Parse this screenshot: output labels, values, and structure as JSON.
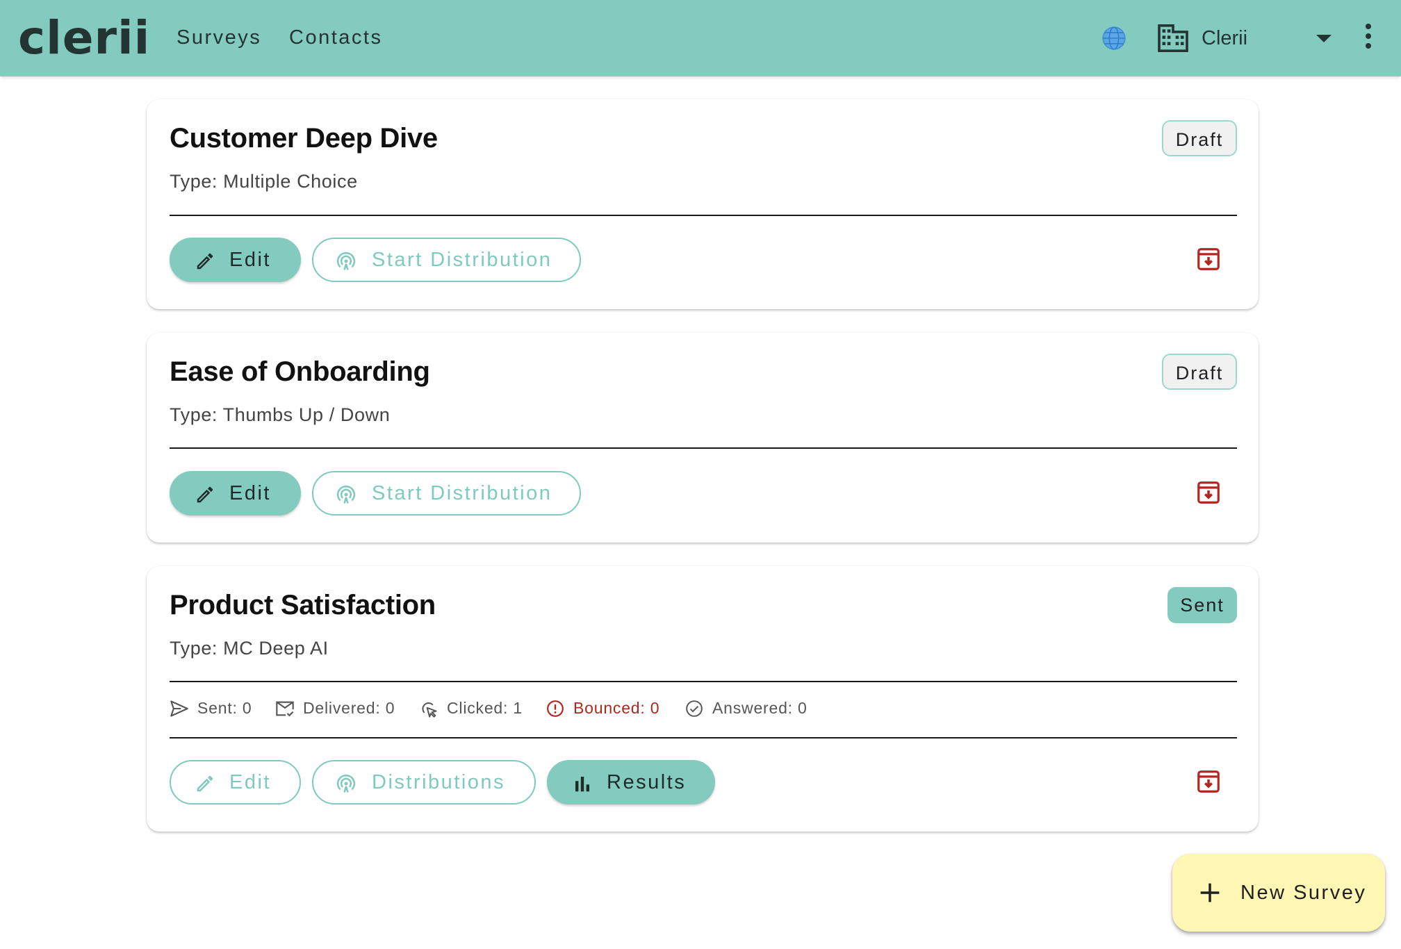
{
  "header": {
    "logo": "clerii",
    "nav": [
      {
        "label": "Surveys"
      },
      {
        "label": "Contacts"
      }
    ],
    "organization": "Clerii",
    "icons": [
      "globe-icon",
      "building-icon",
      "chevron-down-icon",
      "more-vert-icon"
    ]
  },
  "colors": {
    "primary": "#82cbbe",
    "danger": "#b3261e",
    "fab": "#fff7b3"
  },
  "surveys": [
    {
      "title": "Customer Deep Dive",
      "type": "Type: Multiple Choice",
      "status": "Draft",
      "actions": {
        "edit": "Edit",
        "distribute": "Start Distribution"
      }
    },
    {
      "title": "Ease of Onboarding",
      "type": "Type: Thumbs Up / Down",
      "status": "Draft",
      "actions": {
        "edit": "Edit",
        "distribute": "Start Distribution"
      }
    },
    {
      "title": "Product Satisfaction",
      "type": "Type: MC Deep AI",
      "status": "Sent",
      "stats": {
        "sent": "Sent: 0",
        "delivered": "Delivered: 0",
        "clicked": "Clicked: 1",
        "bounced": "Bounced: 0",
        "answered": "Answered: 0"
      },
      "actions": {
        "edit": "Edit",
        "distributions": "Distributions",
        "results": "Results"
      }
    }
  ],
  "fab": {
    "label": "New Survey"
  }
}
